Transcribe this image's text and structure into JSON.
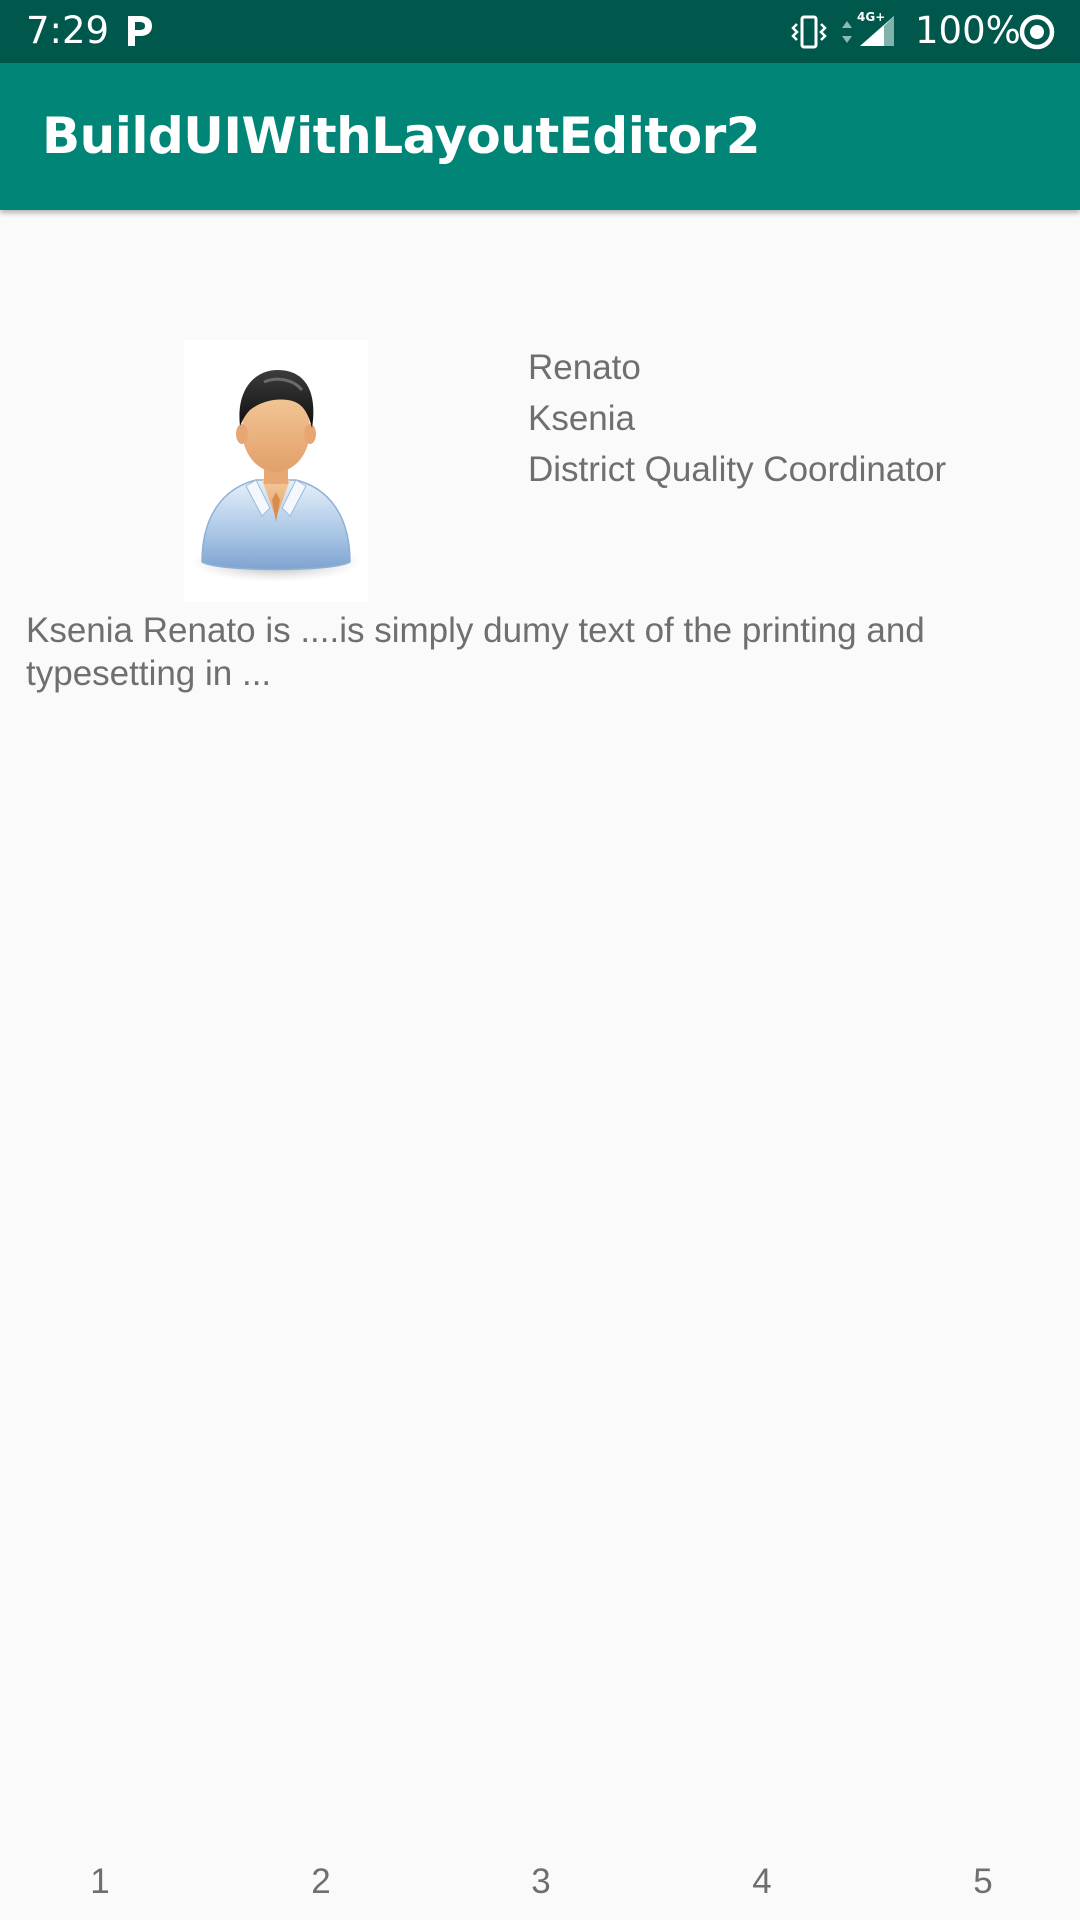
{
  "status_bar": {
    "time": "7:29",
    "network_type": "4G+",
    "battery": "100%",
    "icons": [
      "parking-app-icon",
      "vibrate-icon",
      "data-arrows-icon",
      "signal-icon",
      "battery-saver-icon"
    ]
  },
  "app_bar": {
    "title": "BuildUIWithLayoutEditor2",
    "color": "#008577",
    "status_color": "#00574b"
  },
  "profile": {
    "avatar_icon": "person-avatar-icon",
    "first_name": "Renato",
    "last_name": "Ksenia",
    "job_title": "District Quality Coordinator",
    "bio": "Ksenia Renato is ....is simply dumy text of the printing and typesetting in ..."
  },
  "pager": {
    "pages": [
      "1",
      "2",
      "3",
      "4",
      "5"
    ]
  }
}
